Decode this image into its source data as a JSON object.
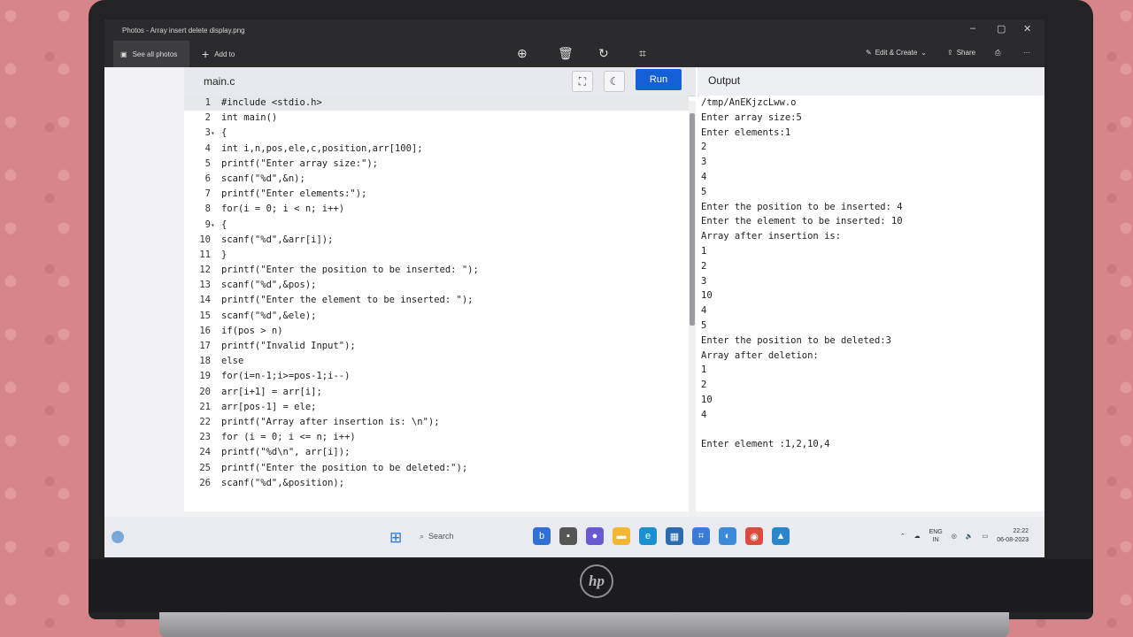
{
  "window": {
    "title": "Photos - Array insert delete display.png",
    "minimize": "–",
    "maximize": "▢",
    "close": "✕"
  },
  "photos_toolbar": {
    "see_all": "See all photos",
    "add_to": "Add to",
    "edit_create": "Edit & Create",
    "share": "Share",
    "more": "···"
  },
  "editor": {
    "tab": "main.c",
    "run_label": "Run",
    "output_title": "Output",
    "lines": [
      {
        "n": "1",
        "fold": "",
        "text": "#include <stdio.h>"
      },
      {
        "n": "2",
        "fold": "",
        "text": "int main()"
      },
      {
        "n": "3",
        "fold": "▾",
        "text": "{"
      },
      {
        "n": "4",
        "fold": "",
        "text": "int i,n,pos,ele,c,position,arr[100];"
      },
      {
        "n": "5",
        "fold": "",
        "text": "printf(\"Enter array size:\");"
      },
      {
        "n": "6",
        "fold": "",
        "text": "scanf(\"%d\",&n);"
      },
      {
        "n": "7",
        "fold": "",
        "text": "printf(\"Enter elements:\");"
      },
      {
        "n": "8",
        "fold": "",
        "text": "for(i = 0; i < n; i++)"
      },
      {
        "n": "9",
        "fold": "▾",
        "text": "{"
      },
      {
        "n": "10",
        "fold": "",
        "text": "scanf(\"%d\",&arr[i]);"
      },
      {
        "n": "11",
        "fold": "",
        "text": "}"
      },
      {
        "n": "12",
        "fold": "",
        "text": "printf(\"Enter the position to be inserted: \");"
      },
      {
        "n": "13",
        "fold": "",
        "text": "scanf(\"%d\",&pos);"
      },
      {
        "n": "14",
        "fold": "",
        "text": "printf(\"Enter the element to be inserted: \");"
      },
      {
        "n": "15",
        "fold": "",
        "text": "scanf(\"%d\",&ele);"
      },
      {
        "n": "16",
        "fold": "",
        "text": "if(pos > n)"
      },
      {
        "n": "17",
        "fold": "",
        "text": "printf(\"Invalid Input\");"
      },
      {
        "n": "18",
        "fold": "",
        "text": "else"
      },
      {
        "n": "19",
        "fold": "",
        "text": "for(i=n-1;i>=pos-1;i--)"
      },
      {
        "n": "20",
        "fold": "",
        "text": "arr[i+1] = arr[i];"
      },
      {
        "n": "21",
        "fold": "",
        "text": "arr[pos-1] = ele;"
      },
      {
        "n": "22",
        "fold": "",
        "text": "printf(\"Array after insertion is: \\n\");"
      },
      {
        "n": "23",
        "fold": "",
        "text": "for (i = 0; i <= n; i++)"
      },
      {
        "n": "24",
        "fold": "",
        "text": "printf(\"%d\\n\", arr[i]);"
      },
      {
        "n": "25",
        "fold": "",
        "text": "printf(\"Enter the position to be deleted:\");"
      },
      {
        "n": "26",
        "fold": "",
        "text": "scanf(\"%d\",&position);"
      }
    ]
  },
  "output": {
    "lines": [
      "/tmp/AnEKjzcLww.o",
      "Enter array size:5",
      "Enter elements:1",
      "2",
      "3",
      "4",
      "5",
      "Enter the position to be inserted: 4",
      "Enter the element to be inserted: 10",
      "Array after insertion is:",
      "1",
      "2",
      "3",
      "10",
      "4",
      "5",
      "Enter the position to be deleted:3",
      "Array after deletion:",
      "1",
      "2",
      "10",
      "4",
      "",
      "Enter element :1,2,10,4"
    ]
  },
  "taskbar": {
    "search": "Search",
    "lang_top": "ENG",
    "lang_bottom": "IN",
    "time": "22:22",
    "date": "06-08-2023"
  },
  "brand": "hp"
}
